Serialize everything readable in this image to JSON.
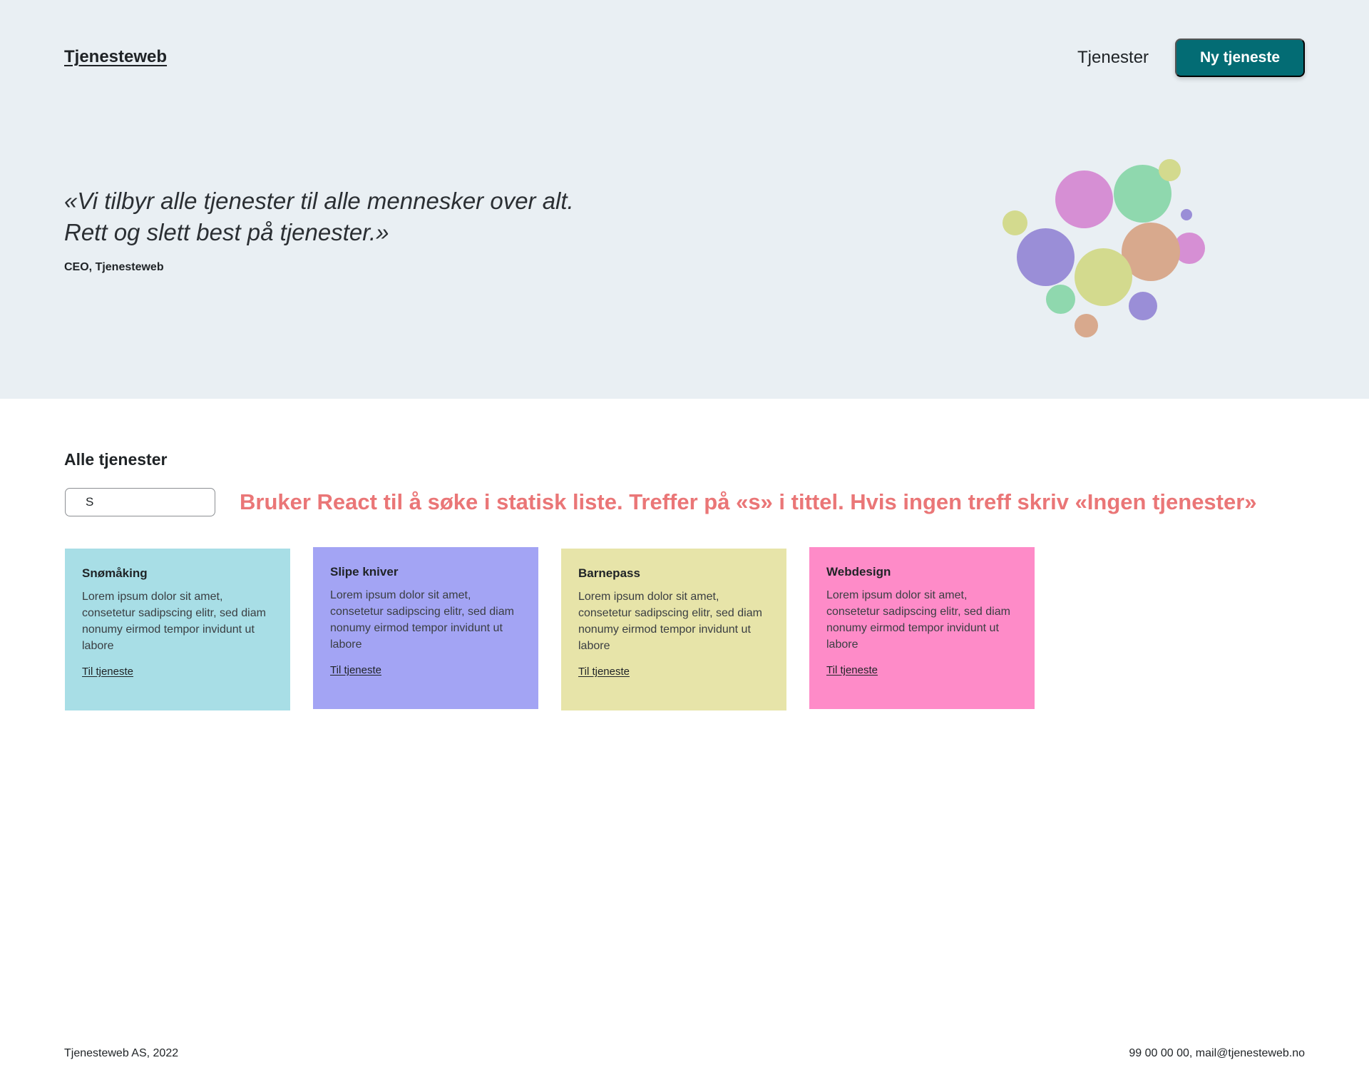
{
  "header": {
    "logo": "Tjenesteweb",
    "nav_link": "Tjenester",
    "cta_label": "Ny tjeneste",
    "accent_color": "#036c74"
  },
  "hero": {
    "quote_line1": "«Vi tilbyr alle tjenester til alle mennesker over alt.",
    "quote_line2": "Rett og slett best på tjenester.»",
    "author": "CEO, Tjenesteweb",
    "bubble_colors": [
      "#d68fd4",
      "#8fd8ae",
      "#d3da8e",
      "#9a8ed7",
      "#d8a98d"
    ]
  },
  "main": {
    "title": "Alle tjenester",
    "search_value": "S",
    "note": "Bruker React til å søke i statisk liste. Treffer på «s» i tittel. Hvis ingen treff skriv «Ingen tjenester»",
    "note_color": "#ea7677",
    "cards": [
      {
        "title": "Snømåking",
        "body": "Lorem ipsum dolor sit amet, consetetur sadipscing elitr, sed diam nonumy eirmod tempor invidunt ut labore",
        "link": "Til tjeneste",
        "color": "#a8dee6"
      },
      {
        "title": "Slipe kniver",
        "body": "Lorem ipsum dolor sit amet, consetetur sadipscing elitr, sed diam nonumy eirmod tempor invidunt ut labore",
        "link": "Til tjeneste",
        "color": "#a3a4f4"
      },
      {
        "title": "Barnepass",
        "body": "Lorem ipsum dolor sit amet, consetetur sadipscing elitr, sed diam nonumy eirmod tempor invidunt ut labore",
        "link": "Til tjeneste",
        "color": "#e7e4a9"
      },
      {
        "title": "Webdesign",
        "body": "Lorem ipsum dolor sit amet, consetetur sadipscing elitr, sed diam nonumy eirmod tempor invidunt ut labore",
        "link": "Til tjeneste",
        "color": "#fe8bc8"
      }
    ]
  },
  "footer": {
    "left": "Tjenesteweb AS, 2022",
    "right": "99 00 00 00, mail@tjenesteweb.no"
  }
}
